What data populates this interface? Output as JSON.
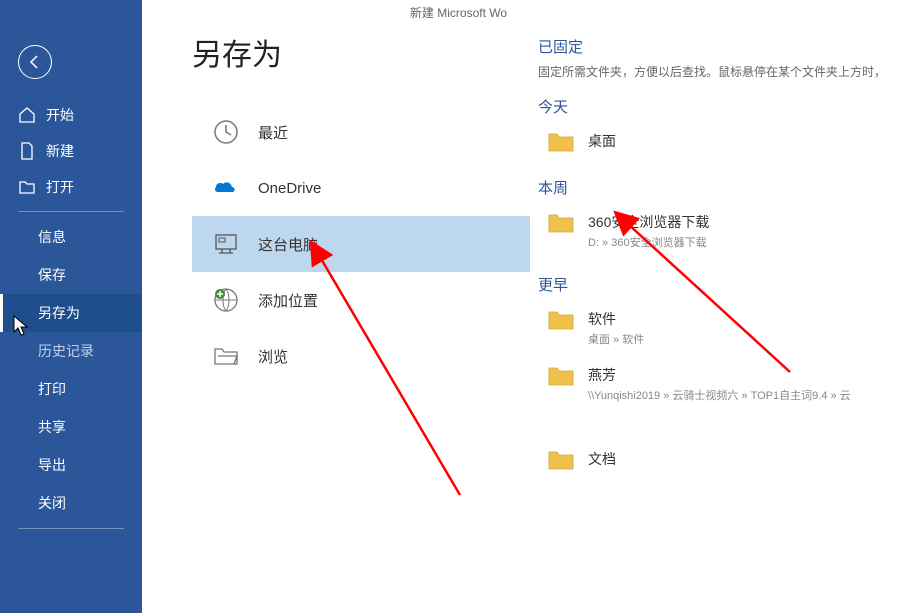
{
  "titlebar": "新建 Microsoft Wo",
  "pageTitle": "另存为",
  "sidebar": {
    "home": "开始",
    "new": "新建",
    "open": "打开",
    "info": "信息",
    "save": "保存",
    "saveAs": "另存为",
    "history": "历史记录",
    "print": "打印",
    "share": "共享",
    "export": "导出",
    "close": "关闭"
  },
  "locations": {
    "recent": "最近",
    "onedrive": "OneDrive",
    "thispc": "这台电脑",
    "addplace": "添加位置",
    "browse": "浏览"
  },
  "right": {
    "pinned": "已固定",
    "pinnedDesc": "固定所需文件夹，方便以后查找。鼠标悬停在某个文件夹上方时，",
    "today": "今天",
    "thisweek": "本周",
    "older": "更早",
    "folders": {
      "desktop": {
        "name": "桌面",
        "path": ""
      },
      "browser360": {
        "name": "360安全浏览器下载",
        "path": "D: » 360安全浏览器下载"
      },
      "software": {
        "name": "软件",
        "path": "桌面 » 软件"
      },
      "yanfang": {
        "name": "燕芳",
        "path": "\\\\Yunqishi2019 » 云骑士视频六 » TOP1自主词9.4 » 云"
      },
      "docs": {
        "name": "文档",
        "path": ""
      }
    }
  }
}
